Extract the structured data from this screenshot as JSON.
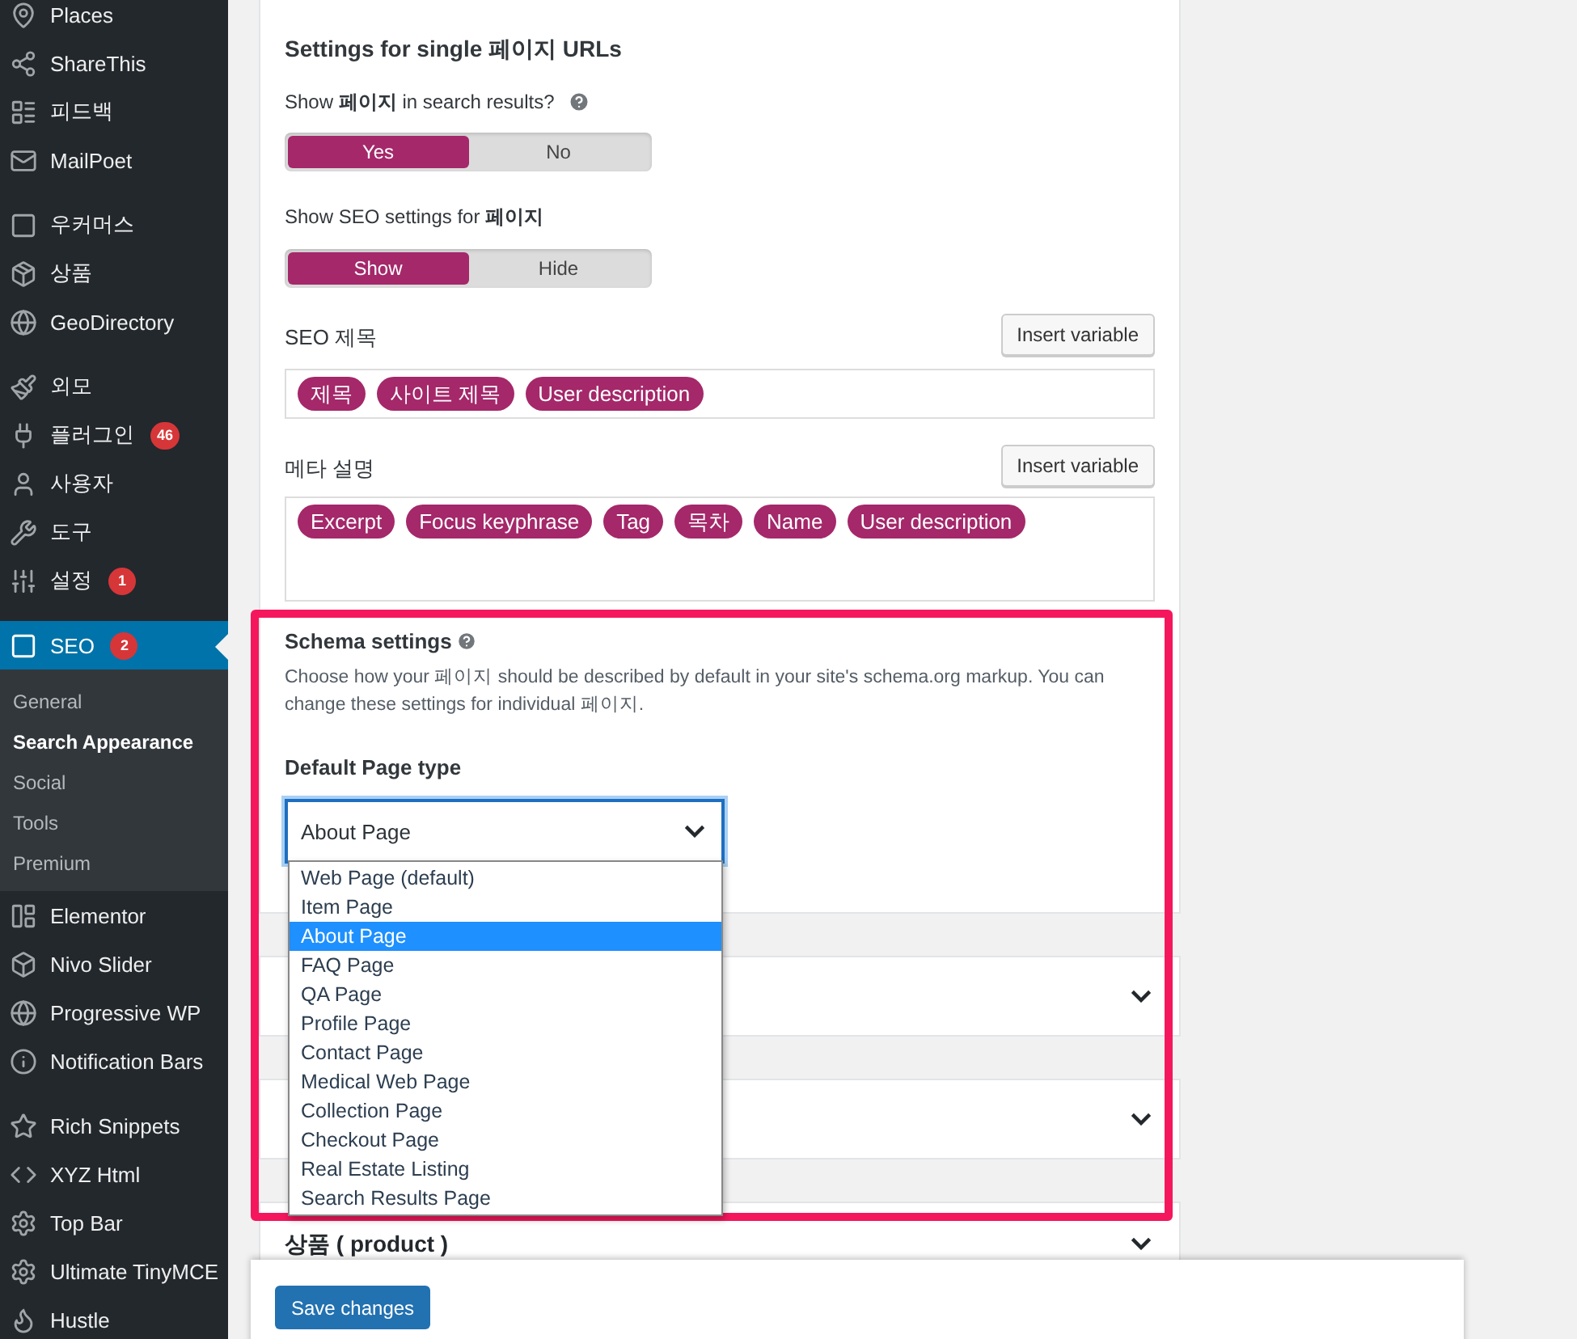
{
  "sidebar": {
    "groups": [
      {
        "items": [
          {
            "label": "Places",
            "selected": false
          },
          {
            "label": "ShareThis",
            "selected": false
          },
          {
            "label": "피드백",
            "selected": false
          },
          {
            "label": "MailPoet",
            "selected": false
          }
        ]
      },
      {
        "items": [
          {
            "label": "우커머스",
            "selected": false
          },
          {
            "label": "상품",
            "selected": false
          },
          {
            "label": "GeoDirectory",
            "selected": false
          }
        ]
      },
      {
        "items": [
          {
            "label": "외모",
            "selected": false
          },
          {
            "label": "플러그인",
            "badge": "46",
            "selected": false
          },
          {
            "label": "사용자",
            "selected": false
          },
          {
            "label": "도구",
            "selected": false
          },
          {
            "label": "설정",
            "badge": "1",
            "selected": false
          }
        ]
      },
      {
        "items": [
          {
            "label": "SEO",
            "badge": "2",
            "selected": true,
            "submenu": [
              {
                "label": "General",
                "selected": false
              },
              {
                "label": "Search Appearance",
                "selected": true
              },
              {
                "label": "Social",
                "selected": false
              },
              {
                "label": "Tools",
                "selected": false
              },
              {
                "label": "Premium",
                "selected": false
              }
            ]
          },
          {
            "label": "Elementor",
            "selected": false
          },
          {
            "label": "Nivo Slider",
            "selected": false
          },
          {
            "label": "Progressive WP",
            "selected": false
          },
          {
            "label": "Notification Bars",
            "selected": false
          }
        ]
      },
      {
        "items": [
          {
            "label": "Rich Snippets",
            "selected": false
          },
          {
            "label": "XYZ Html",
            "selected": false
          },
          {
            "label": "Top Bar",
            "selected": false
          },
          {
            "label": "Ultimate TinyMCE",
            "selected": false
          },
          {
            "label": "Hustle",
            "selected": false
          }
        ]
      }
    ]
  },
  "single_urls": {
    "heading": "Settings for single 페이지 URLs"
  },
  "show_in_search": {
    "label": "Show **페이지** in search results?",
    "options": [
      {
        "label": "Yes",
        "selected": true
      },
      {
        "label": "No",
        "selected": false
      }
    ]
  },
  "show_seo_settings": {
    "label": "Show SEO settings for **페이지**",
    "options": [
      {
        "label": "Show",
        "selected": true
      },
      {
        "label": "Hide",
        "selected": false
      }
    ]
  },
  "seo_title": {
    "label": "SEO 제목",
    "button": "Insert variable",
    "tags": [
      "제목",
      "사이트 제목",
      "User description"
    ]
  },
  "meta_description": {
    "label": "메타 설명",
    "button": "Insert variable",
    "tags": [
      "Excerpt",
      "Focus keyphrase",
      "Tag",
      "목차",
      "Name",
      "User description"
    ]
  },
  "schema": {
    "heading": "Schema settings",
    "description": "Choose how your 페이지 should be described by default in your site's schema.org markup. You can change these settings for individual 페이지.",
    "field_label": "Default Page type",
    "value": "About Page",
    "expanded": true,
    "options": [
      {
        "label": "Web Page (default)",
        "selected": false
      },
      {
        "label": "Item Page",
        "selected": false
      },
      {
        "label": "About Page",
        "selected": true
      },
      {
        "label": "FAQ Page",
        "selected": false
      },
      {
        "label": "QA Page",
        "selected": false
      },
      {
        "label": "Profile Page",
        "selected": false
      },
      {
        "label": "Contact Page",
        "selected": false
      },
      {
        "label": "Medical Web Page",
        "selected": false
      },
      {
        "label": "Collection Page",
        "selected": false
      },
      {
        "label": "Checkout Page",
        "selected": false
      },
      {
        "label": "Real Estate Listing",
        "selected": false
      },
      {
        "label": "Search Results Page",
        "selected": false
      }
    ]
  },
  "product_section": {
    "title": "상품 ( product )"
  },
  "save_button": "Save changes"
}
